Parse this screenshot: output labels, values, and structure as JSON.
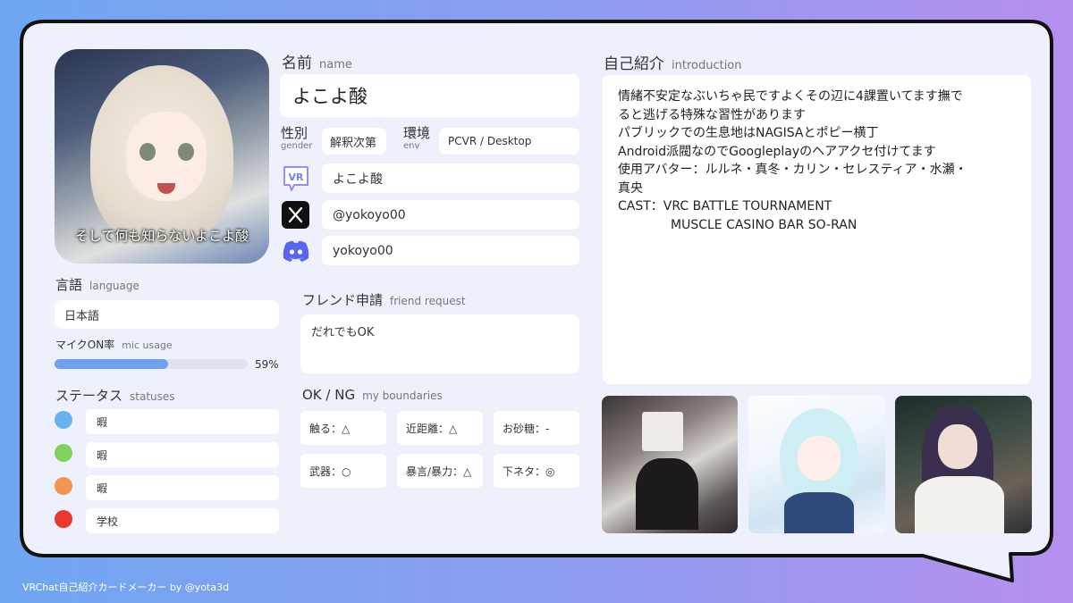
{
  "profile": {
    "caption": "そして何も知らないよこよ酸",
    "name_label": "名前",
    "name_label_en": "name",
    "name": "よこよ酸",
    "gender_label": "性別",
    "gender_label_en": "gender",
    "gender": "解釈次第",
    "env_label": "環境",
    "env_label_en": "env",
    "env": "PCVR / Desktop",
    "vrchat_id": "よこよ酸",
    "x_id": "@yokoyo00",
    "discord_id": "yokoyo00"
  },
  "language": {
    "label": "言語",
    "label_en": "language",
    "value": "日本語"
  },
  "mic": {
    "label": "マイクON率",
    "label_en": "mic usage",
    "percent_text": "59%",
    "value": 0.59
  },
  "statuses": {
    "label": "ステータス",
    "label_en": "statuses",
    "items": [
      {
        "color": "#6ab2ee",
        "text": "暇"
      },
      {
        "color": "#7fd35a",
        "text": "暇"
      },
      {
        "color": "#f2954f",
        "text": "暇"
      },
      {
        "color": "#e9382f",
        "text": "学校"
      }
    ]
  },
  "friend": {
    "label": "フレンド申請",
    "label_en": "friend request",
    "value": "だれでもOK"
  },
  "boundaries": {
    "label": "OK / NG",
    "label_en": "my boundaries",
    "items": [
      "触る：△",
      "近距離：△",
      "お砂糖：-",
      "武器：○",
      "暴言/暴力：△",
      "下ネタ：◎"
    ]
  },
  "intro": {
    "label": "自己紹介",
    "label_en": "introduction",
    "lines": [
      "情緒不安定なぶいちゃ民ですよくその辺に4課置いてます撫で",
      "ると逃げる特殊な習性があります",
      "パブリックでの生息地はNAGISAとポピー横丁",
      "Android派閥なのでGoogleplayのヘアアクセ付けてます",
      "使用アバター：ルルネ・真冬・カリン・セレスティア・水瀬・",
      "真央",
      "CAST：VRC BATTLE TOURNAMENT",
      "MUSCLE CASINO BAR SO-RAN"
    ]
  },
  "footer": "VRChat自己紹介カードメーカー by @yota3d"
}
